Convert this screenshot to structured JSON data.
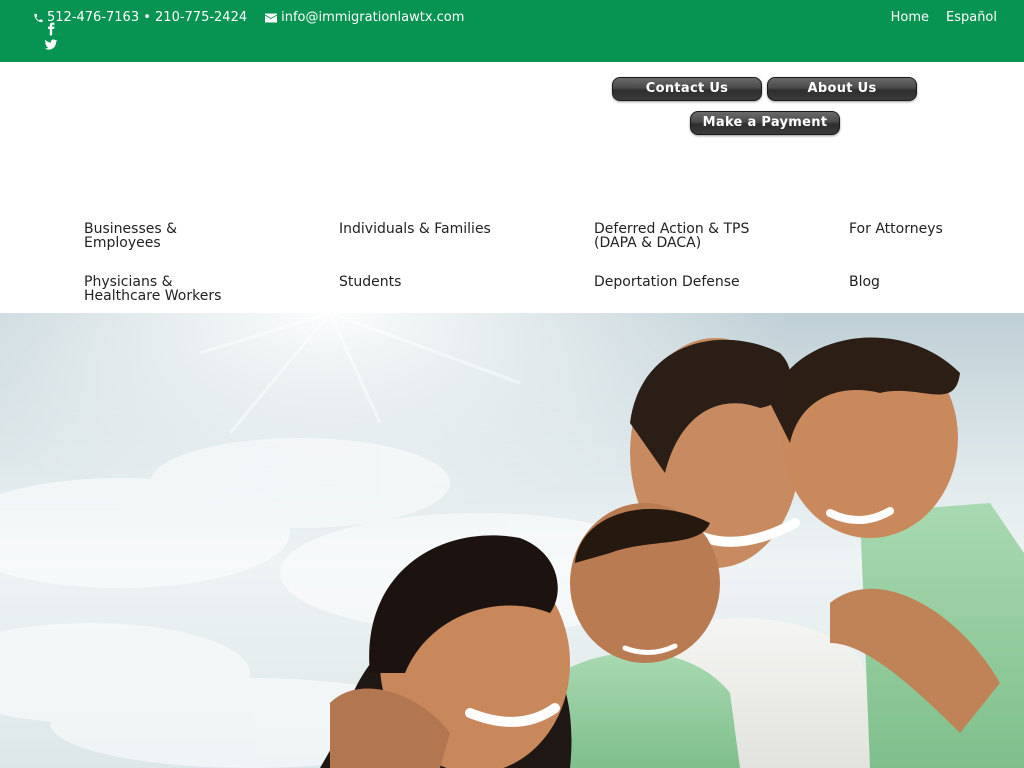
{
  "topbar": {
    "phone": "512-476-7163 • 210-775-2424",
    "email": "info@immigrationlawtx.com",
    "links": [
      "Home",
      "Español"
    ]
  },
  "buttons": {
    "contact": "Contact Us",
    "about": "About Us",
    "payment": "Make a Payment"
  },
  "menu": [
    "Businesses & Employees",
    "Individuals & Families",
    "Deferred Action & TPS (DAPA & DACA)",
    "For Attorneys",
    "Physicians & Healthcare Workers",
    "Students",
    "Deportation Defense",
    "Blog"
  ],
  "colors": {
    "topbar": "#079352",
    "button": "#3b3b3b"
  },
  "icons": [
    "phone-icon",
    "email-icon",
    "facebook-icon",
    "twitter-icon"
  ]
}
